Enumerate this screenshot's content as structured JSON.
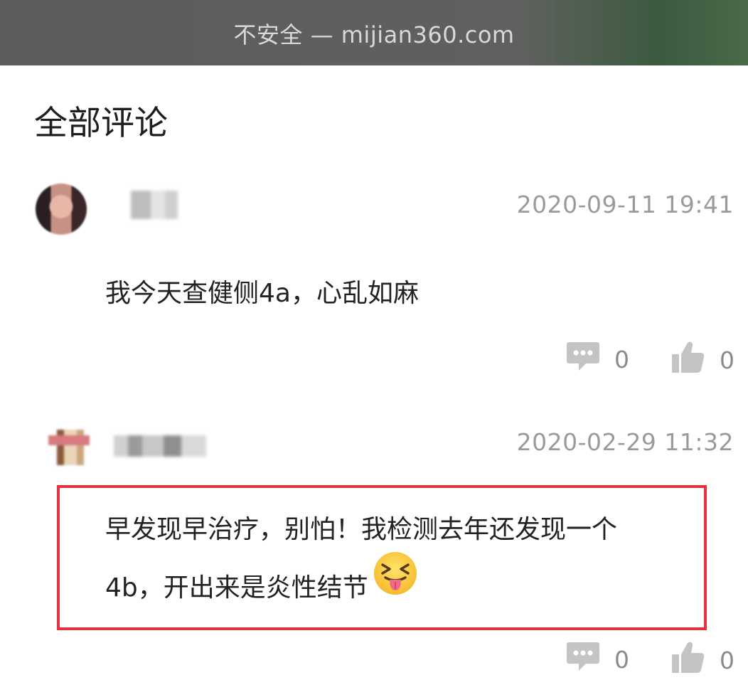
{
  "browser": {
    "address_text": "不安全 — mijian360.com"
  },
  "section": {
    "title": "全部评论"
  },
  "comments": [
    {
      "timestamp": "2020-09-11 19:41",
      "text": "我今天查健侧4a，心乱如麻",
      "reply_count": "0",
      "like_count": "0"
    },
    {
      "timestamp": "2020-02-29 11:32",
      "text_line1": "早发现早治疗，别怕！我检测去年还发现一个",
      "text_line2": "4b，开出来是炎性结节",
      "emoji": "squinting-face-with-tongue",
      "reply_count": "0",
      "like_count": "0"
    }
  ],
  "colors": {
    "highlight_border": "#e2333f",
    "meta_text": "#9a9a9a",
    "icon_gray": "#c4c4c4"
  }
}
